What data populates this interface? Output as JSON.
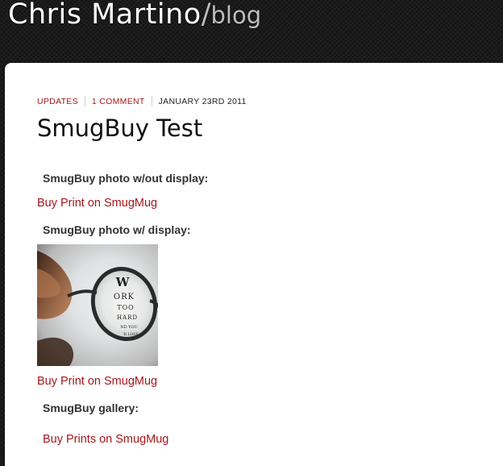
{
  "header": {
    "site_name": "Chris Martino",
    "separator": "/",
    "section": "blog"
  },
  "post": {
    "meta": {
      "category": "UPDATES",
      "comments": "1 COMMENT",
      "date": "JANUARY 23RD 2011"
    },
    "title": "SmugBuy Test",
    "section1": {
      "heading": "SmugBuy photo w/out display:",
      "link": "Buy Print on SmugMug"
    },
    "section2": {
      "heading": "SmugBuy photo w/ display:",
      "photo_text": [
        "W",
        "ORK",
        "TOO",
        "HARD",
        "ND YOU",
        "'R LOSE"
      ],
      "link": "Buy Print on SmugMug"
    },
    "section3": {
      "heading": "SmugBuy gallery:",
      "link": "Buy Prints on SmugMug"
    }
  },
  "colors": {
    "link": "#a7161b",
    "background": "#1b1b1b",
    "content_bg": "#ffffff"
  }
}
